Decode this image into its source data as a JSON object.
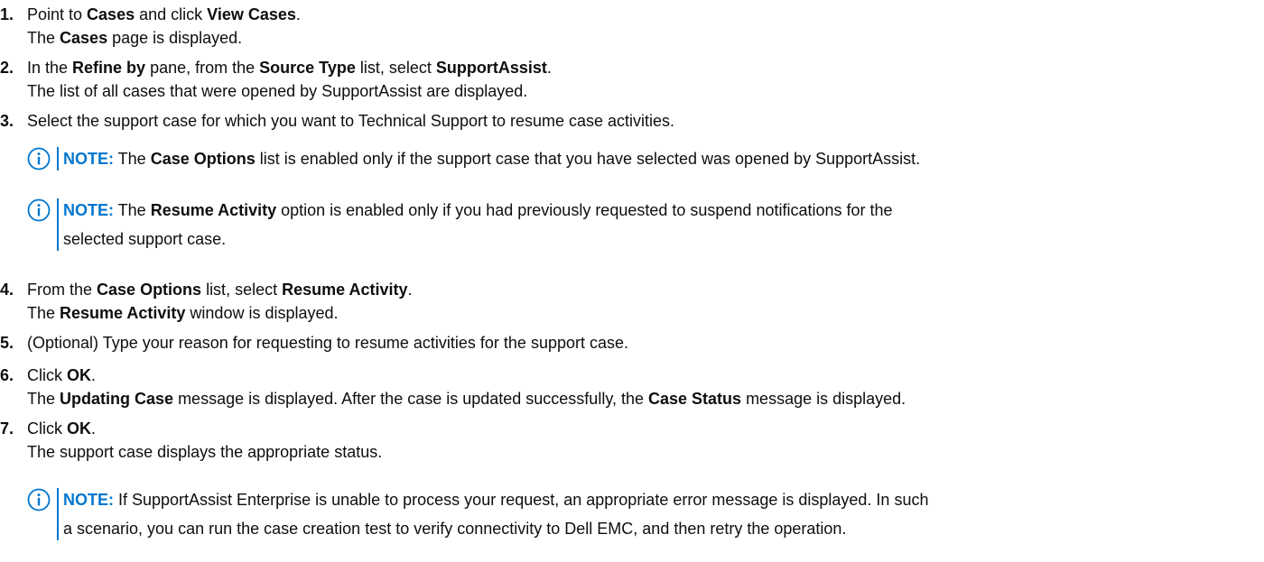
{
  "steps": [
    {
      "num": "1.",
      "lines": [
        [
          {
            "t": "Point to ",
            "b": false
          },
          {
            "t": "Cases",
            "b": true
          },
          {
            "t": " and click ",
            "b": false
          },
          {
            "t": "View Cases",
            "b": true
          },
          {
            "t": ".",
            "b": false
          }
        ],
        [
          {
            "t": "The ",
            "b": false
          },
          {
            "t": "Cases",
            "b": true
          },
          {
            "t": " page is displayed.",
            "b": false
          }
        ]
      ]
    },
    {
      "num": "2.",
      "lines": [
        [
          {
            "t": "In the ",
            "b": false
          },
          {
            "t": "Refine by",
            "b": true
          },
          {
            "t": " pane, from the ",
            "b": false
          },
          {
            "t": "Source Type",
            "b": true
          },
          {
            "t": " list, select ",
            "b": false
          },
          {
            "t": "SupportAssist",
            "b": true
          },
          {
            "t": ".",
            "b": false
          }
        ],
        [
          {
            "t": "The list of all cases that were opened by SupportAssist are displayed.",
            "b": false
          }
        ]
      ]
    },
    {
      "num": "3.",
      "lines": [
        [
          {
            "t": "Select the support case for which you want to Technical Support to resume case activities.",
            "b": false
          }
        ]
      ]
    },
    {
      "num": "4.",
      "lines": [
        [
          {
            "t": "From the ",
            "b": false
          },
          {
            "t": "Case Options",
            "b": true
          },
          {
            "t": " list, select ",
            "b": false
          },
          {
            "t": "Resume Activity",
            "b": true
          },
          {
            "t": ".",
            "b": false
          }
        ],
        [
          {
            "t": "The ",
            "b": false
          },
          {
            "t": "Resume Activity",
            "b": true
          },
          {
            "t": " window is displayed.",
            "b": false
          }
        ]
      ]
    },
    {
      "num": "5.",
      "lines": [
        [
          {
            "t": "(Optional) Type your reason for requesting to resume activities for the support case.",
            "b": false
          }
        ]
      ]
    },
    {
      "num": "6.",
      "lines": [
        [
          {
            "t": "Click ",
            "b": false
          },
          {
            "t": "OK",
            "b": true
          },
          {
            "t": ".",
            "b": false
          }
        ],
        [
          {
            "t": "The ",
            "b": false
          },
          {
            "t": "Updating Case",
            "b": true
          },
          {
            "t": " message is displayed. After the case is updated successfully, the ",
            "b": false
          },
          {
            "t": "Case Status",
            "b": true
          },
          {
            "t": " message is displayed.",
            "b": false
          }
        ]
      ]
    },
    {
      "num": "7.",
      "lines": [
        [
          {
            "t": "Click ",
            "b": false
          },
          {
            "t": "OK",
            "b": true
          },
          {
            "t": ".",
            "b": false
          }
        ],
        [
          {
            "t": "The support case displays the appropriate status.",
            "b": false
          }
        ]
      ]
    }
  ],
  "notes": [
    {
      "label": "NOTE:",
      "lines": [
        [
          {
            "t": " The ",
            "b": false
          },
          {
            "t": "Case Options",
            "b": true
          },
          {
            "t": " list is enabled only if the support case that you have selected was opened by SupportAssist.",
            "b": false
          }
        ]
      ]
    },
    {
      "label": "NOTE:",
      "lines": [
        [
          {
            "t": " The ",
            "b": false
          },
          {
            "t": "Resume Activity",
            "b": true
          },
          {
            "t": " option is enabled only if you had previously requested to suspend notifications for the",
            "b": false
          }
        ],
        [
          {
            "t": "selected support case.",
            "b": false
          }
        ]
      ]
    },
    {
      "label": "NOTE:",
      "lines": [
        [
          {
            "t": " If SupportAssist Enterprise is unable to process your request, an appropriate error message is displayed. In such",
            "b": false
          }
        ],
        [
          {
            "t": "a scenario, you can run the case creation test to verify connectivity to Dell EMC, and then retry the operation.",
            "b": false
          }
        ]
      ]
    }
  ],
  "colors": {
    "note_accent": "#0076ce",
    "text": "#0e0e0e"
  },
  "icons": {
    "note": "info-circle-icon"
  }
}
